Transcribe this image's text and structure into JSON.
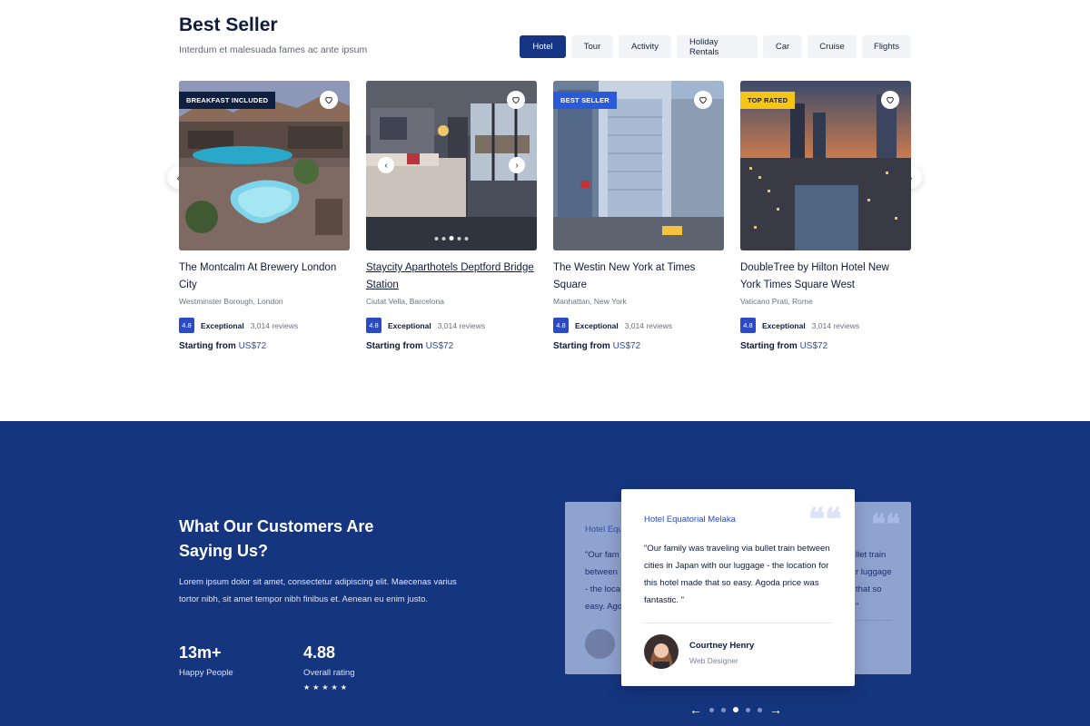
{
  "header": {
    "title": "Best Seller",
    "subtitle": "Interdum et malesuada fames ac ante ipsum"
  },
  "tabs": [
    {
      "label": "Hotel",
      "active": true
    },
    {
      "label": "Tour"
    },
    {
      "label": "Activity"
    },
    {
      "label": "Holiday Rentals"
    },
    {
      "label": "Car"
    },
    {
      "label": "Cruise"
    },
    {
      "label": "Flights"
    }
  ],
  "cards": [
    {
      "badge": "BREAKFAST INCLUDED",
      "title": "The Montcalm At Brewery London City",
      "location": "Westminster Borough, London",
      "score": "4.8",
      "rating_label": "Exceptional",
      "reviews": "3,014 reviews",
      "price_prefix": "Starting from",
      "price": "US$72"
    },
    {
      "badge": "",
      "title": "Staycity Aparthotels Deptford Bridge Station",
      "location": "Ciutat Vella, Barcelona",
      "score": "4.8",
      "rating_label": "Exceptional",
      "reviews": "3,014 reviews",
      "price_prefix": "Starting from",
      "price": "US$72"
    },
    {
      "badge": "BEST SELLER",
      "title": "The Westin New York at Times Square",
      "location": "Manhattan, New York",
      "score": "4.8",
      "rating_label": "Exceptional",
      "reviews": "3,014 reviews",
      "price_prefix": "Starting from",
      "price": "US$72"
    },
    {
      "badge": "TOP RATED",
      "title": "DoubleTree by Hilton Hotel New York Times Square West",
      "location": "Vaticano Prati, Rome",
      "score": "4.8",
      "rating_label": "Exceptional",
      "reviews": "3,014 reviews",
      "price_prefix": "Starting from",
      "price": "US$72"
    }
  ],
  "testimonials": {
    "heading": "What Our Customers Are Saying Us?",
    "text": "Lorem ipsum dolor sit amet, consectetur adipiscing elit. Maecenas varius tortor nibh, sit amet tempor nibh finibus et. Aenean eu enim justo.",
    "stats": [
      {
        "value": "13m+",
        "label": "Happy People"
      },
      {
        "value": "4.88",
        "label": "Overall rating",
        "stars": "★★★★★"
      }
    ],
    "ghost_left": {
      "hotel": "Hotel Equ",
      "lines": [
        "\"Our fam",
        "between",
        "- the loca",
        "easy. Ago"
      ]
    },
    "ghost_right": {
      "lines": [
        "llet train",
        "r luggage",
        "that so",
        "\""
      ]
    },
    "active": {
      "hotel": "Hotel Equatorial Melaka",
      "quote": "\"Our family was traveling via bullet train between cities in Japan with our luggage - the location for this hotel made that so easy. Agoda price was fantastic. \"",
      "name": "Courtney Henry",
      "role": "Web Designer"
    },
    "quote_mark": "❝❝",
    "nav": {
      "prev": "←",
      "next": "→",
      "active_index": 2,
      "count": 5
    }
  },
  "colors": {
    "primary": "#163584",
    "accent": "#2b4ac4",
    "section_bg": "#15357f"
  }
}
